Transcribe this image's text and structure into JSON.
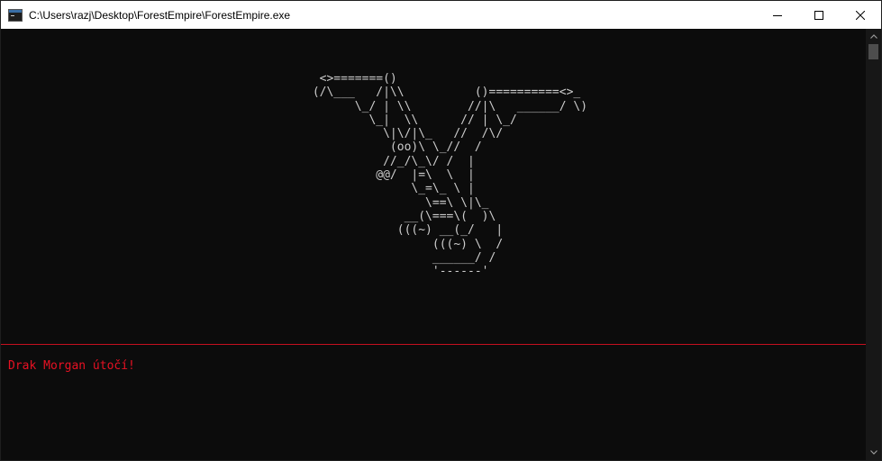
{
  "window": {
    "title": "C:\\Users\\razj\\Desktop\\ForestEmpire\\ForestEmpire.exe",
    "icon": "console-app-icon",
    "controls": [
      "minimize-icon",
      "maximize-icon",
      "close-icon"
    ]
  },
  "console": {
    "ascii_art": "  <>=======()\n (/\\___   /|\\\\          ()==========<>_\n       \\_/ | \\\\        //|\\   ______/ \\)\n         \\_|  \\\\      // | \\_/\n           \\|\\/|\\_   //  /\\/\n            (oo)\\ \\_//  /\n           //_/\\_\\/ /  |\n          @@/  |=\\  \\  |\n               \\_=\\_ \\ |\n                 \\==\\ \\|\\_\n              __(\\===\\(  )\\\n             (((~) __(_/   |\n                  (((~) \\  /\n                  ______/ /\n                  '------'",
    "message": "Drak Morgan útočí!"
  },
  "colors": {
    "background": "#0c0c0c",
    "ascii_text": "#cccccc",
    "message_text": "#e81123",
    "divider": "#c50f1f",
    "titlebar": "#ffffff"
  }
}
